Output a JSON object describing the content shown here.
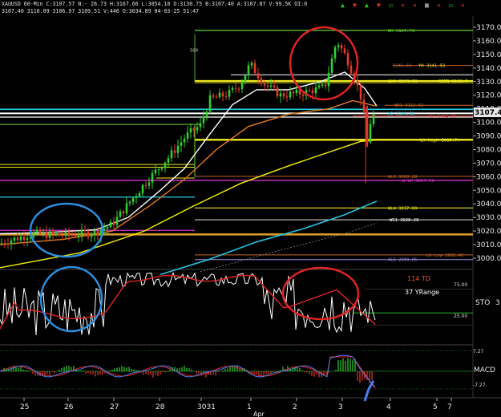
{
  "header": {
    "line1": "XAUUSD 60-Min C:3107.57 N:- 26.73 H:3167.66 L:3054.10 O:3130.75 B:3107.40 A:3107.87 V:99.5K OI:0",
    "line2": "3107.40 3110.09 3106.97 3109.51 V:446 O:3034.89 04-03-25 51:47",
    "symbol": "XAUUSD",
    "toolbar_icons": [
      "up-arrow-icon",
      "down-arrow-icon",
      "up-arrow-icon",
      "down-arrow-icon",
      "checkbox-icon",
      "cross-icon",
      "cross-icon",
      "grid-icon",
      "cross-icon",
      "checkbox-icon",
      "cross-icon"
    ]
  },
  "price_axis": {
    "ticks": [
      "3170.00",
      "3160.00",
      "3150.00",
      "3140.00",
      "3130.00",
      "3120.00",
      "3110.00",
      "3100.00",
      "3090.00",
      "3080.00",
      "3070.00",
      "3060.00",
      "3050.00",
      "3040.00",
      "3030.00",
      "3020.00",
      "3010.00",
      "3000.00"
    ],
    "current_price": "3107.4"
  },
  "level_labels": {
    "wh": "WH 3167.73",
    "yh": "YH 3141.93",
    "r_top": "3141.93",
    "wh4": "WH4 3129.78",
    "rsmr": "RSMR 3130.7",
    "wr1": "WR1 3112.62",
    "wo": "WO 3106.58",
    "yl": "YL 3104.65",
    "lh_high": "LH High 3086.74",
    "al3": "AL3 3060.28",
    "wp": "W WP 3057.51",
    "wl4": "WL4 3037.00",
    "w51": "W51 3028.28",
    "lh_low": "LH Low 3002.40",
    "al5": "AL5 2999.05",
    "mark500": "500"
  },
  "indicators": {
    "td": "114 TD",
    "yrange": "37 YRange",
    "sto_label": "STO",
    "sto_value": "3",
    "sto_75": "75.00",
    "sto_25": "25.00",
    "macd_label": "MACD",
    "macd_top": "7.27",
    "macd_bottom": "-7.27"
  },
  "time_axis": {
    "labels": [
      "25",
      "26",
      "27",
      "28",
      "3031",
      "1",
      "2",
      "3",
      "4",
      "5",
      "7"
    ],
    "month": "Apr"
  },
  "colors": {
    "background": "#000000",
    "candle_up": "#2fd12f",
    "candle_down": "#e23a2a",
    "sma_white": "#ffffff",
    "sma_orange": "#e07a22",
    "sma_yellow": "#f4f000",
    "sma_cyan": "#22c3e0",
    "circle_red": "#e02424",
    "circle_blue": "#2a8fe0"
  }
}
